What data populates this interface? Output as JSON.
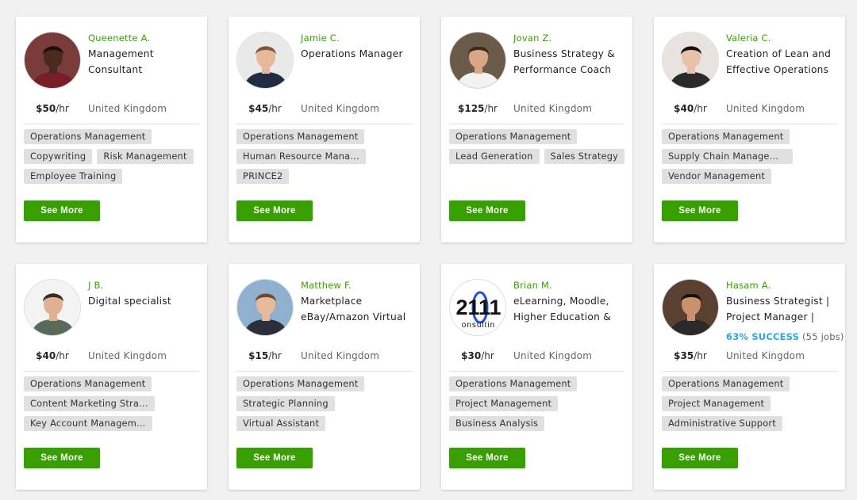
{
  "cards": [
    {
      "name": "Queenette A.",
      "title": "Management Consultant",
      "rate": "$50",
      "rate_unit": "/hr",
      "location": "United Kingdom",
      "skills": [
        "Operations Management",
        "Copywriting",
        "Risk Management",
        "Employee Training"
      ],
      "button": "See More",
      "avatar": "person-photo"
    },
    {
      "name": "Jamie C.",
      "title": "Operations Manager",
      "rate": "$45",
      "rate_unit": "/hr",
      "location": "United Kingdom",
      "skills": [
        "Operations Management",
        "Human Resource Mana...",
        "PRINCE2"
      ],
      "button": "See More",
      "avatar": "person-photo"
    },
    {
      "name": "Jovan Z.",
      "title": "Business Strategy & Performance Coach",
      "rate": "$125",
      "rate_unit": "/hr",
      "location": "United Kingdom",
      "skills": [
        "Operations Management",
        "Lead Generation",
        "Sales Strategy"
      ],
      "button": "See More",
      "avatar": "person-photo"
    },
    {
      "name": "Valeria C.",
      "title": "Creation of Lean and Effective Operations",
      "rate": "$40",
      "rate_unit": "/hr",
      "location": "United Kingdom",
      "skills": [
        "Operations Management",
        "Supply Chain Managem...",
        "Vendor Management"
      ],
      "button": "See More",
      "avatar": "person-photo"
    },
    {
      "name": "J B.",
      "title": "Digital specialist",
      "rate": "$40",
      "rate_unit": "/hr",
      "location": "United Kingdom",
      "skills": [
        "Operations Management",
        "Content Marketing Stra...",
        "Key Account Managem..."
      ],
      "button": "See More",
      "avatar": "person-photo"
    },
    {
      "name": "Matthew F.",
      "title": "Marketplace eBay/Amazon Virtual",
      "rate": "$15",
      "rate_unit": "/hr",
      "location": "United Kingdom",
      "skills": [
        "Operations Management",
        "Strategic Planning",
        "Virtual Assistant"
      ],
      "button": "See More",
      "avatar": "person-photo"
    },
    {
      "name": "Brian M.",
      "title": "eLearning, Moodle, Higher Education &",
      "rate": "$30",
      "rate_unit": "/hr",
      "location": "United Kingdom",
      "skills": [
        "Operations Management",
        "Project Management",
        "Business Analysis"
      ],
      "button": "See More",
      "avatar": "logo",
      "logo_text": "2111",
      "logo_sub": "onsultin"
    },
    {
      "name": "Hasam A.",
      "title": "Business Strategist | Project Manager |",
      "rate": "$35",
      "rate_unit": "/hr",
      "location": "United Kingdom",
      "success_pct": "63% SUCCESS",
      "success_jobs": "(55 jobs)",
      "skills": [
        "Operations Management",
        "Project Management",
        "Administrative Support"
      ],
      "button": "See More",
      "avatar": "person-photo"
    }
  ],
  "colors": {
    "accent": "#37a000",
    "success": "#28a7e0"
  }
}
